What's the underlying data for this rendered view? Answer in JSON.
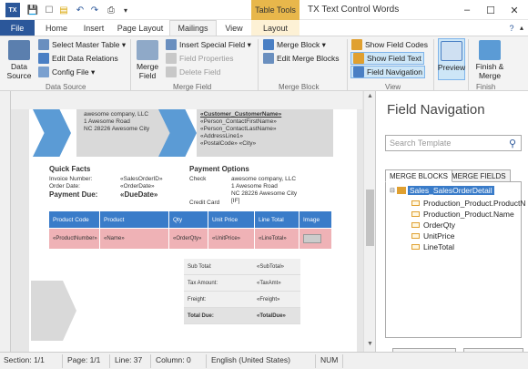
{
  "window": {
    "title": "TX Text Control Words",
    "contextual_group": "Table Tools"
  },
  "tabs": [
    "File",
    "Home",
    "Insert",
    "Page Layout",
    "Mailings",
    "View",
    "Layout"
  ],
  "ribbon": {
    "data_source": {
      "label": "Data Source",
      "big_button": "Data Source",
      "select_master_table": "Select Master Table",
      "edit_data_relations": "Edit Data Relations",
      "config_file": "Config File"
    },
    "merge_field": {
      "label": "Merge Field",
      "big_button": "Merge Field",
      "insert_special_field": "Insert Special Field",
      "field_properties": "Field Properties",
      "delete_field": "Delete Field"
    },
    "merge_block": {
      "label": "Merge Block",
      "merge_block": "Merge Block",
      "edit_merge_blocks": "Edit Merge Blocks"
    },
    "view": {
      "label": "View",
      "show_field_codes": "Show Field Codes",
      "show_field_text": "Show Field Text",
      "field_navigation": "Field Navigation"
    },
    "preview": {
      "label": "Preview"
    },
    "finish": {
      "label": "Finish",
      "big_button": "Finish & Merge"
    }
  },
  "document": {
    "company_lines": [
      "awesome company, LLC",
      "1 Awesome Road",
      "NC 28226 Awesome City"
    ],
    "customer_lines": [
      "«Customer_CustomerName»",
      "«Person_ContactFirstName»",
      "«Person_ContactLastName»",
      "«AddressLine1»",
      "«PostalCode» «City»"
    ],
    "quick_facts_title": "Quick Facts",
    "invoice_number_label": "Invoice Number:",
    "invoice_number_value": "«SalesOrderID»",
    "order_date_label": "Order Date:",
    "order_date_value": "«OrderDate»",
    "payment_due_label": "Payment Due:",
    "payment_due_value": "«DueDate»",
    "payment_options_title": "Payment Options",
    "check_label": "Check",
    "check_lines": [
      "awesome company, LLC",
      "1 Awesome Road",
      "NC 28226 Awesome City",
      "[IF]"
    ],
    "credit_card_label": "Credit Card",
    "table_headers": [
      "Product Code",
      "Product",
      "Qty",
      "Unit Price",
      "Line Total",
      "Image"
    ],
    "table_row": [
      "«ProductNumber»",
      "«Name»",
      "«OrderQty»",
      "«UnitPrice»",
      "«LineTotal»",
      ""
    ],
    "totals": [
      {
        "label": "Sub Total:",
        "value": "«SubTotal»"
      },
      {
        "label": "Tax Amount:",
        "value": "«TaxAmt»"
      },
      {
        "label": "Freight:",
        "value": "«Freight»"
      },
      {
        "label": "Total Due:",
        "value": "«TotalDue»"
      }
    ]
  },
  "status_bar": {
    "section": "Section: 1/1",
    "page": "Page: 1/1",
    "line": "Line: 37",
    "column": "Column: 0",
    "language": "English (United States)",
    "num": "NUM"
  },
  "pane": {
    "title": "Field Navigation",
    "search_placeholder": "Search Template",
    "tab_blocks": "MERGE BLOCKS",
    "tab_fields": "MERGE FIELDS",
    "root": "Sales_SalesOrderDetail",
    "children": [
      "Production_Product.ProductN",
      "Production_Product.Name",
      "OrderQty",
      "UnitPrice",
      "LineTotal"
    ],
    "remove_button": "Remove",
    "properties_button": "Properties..."
  }
}
